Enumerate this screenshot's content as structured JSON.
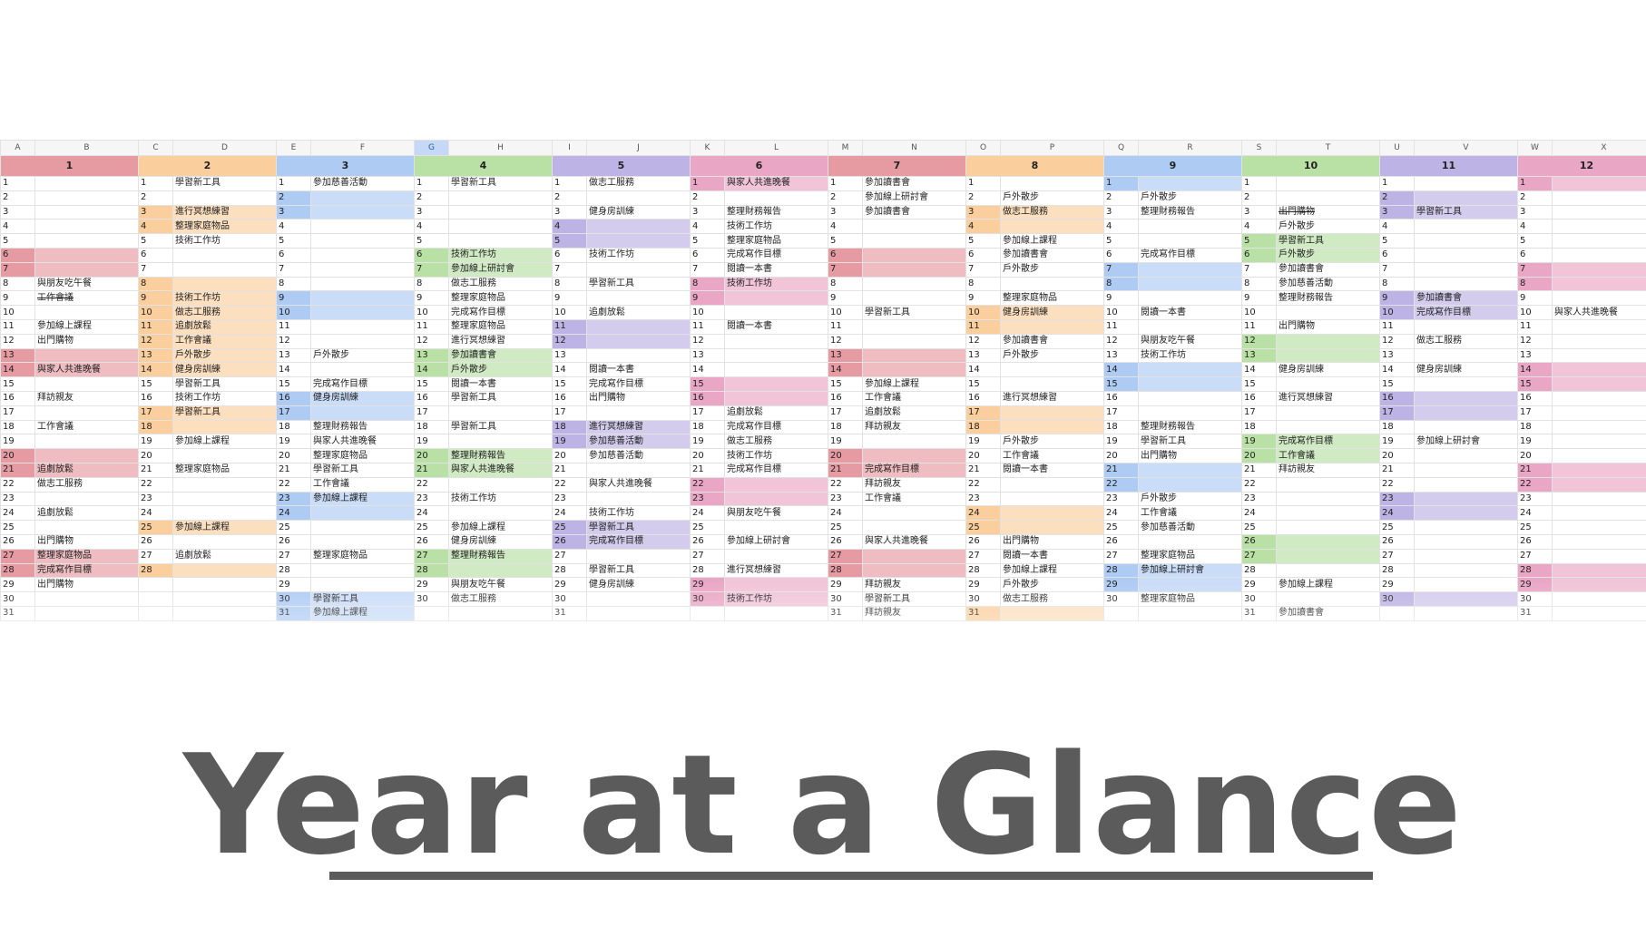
{
  "page_title": "Year at a Glance",
  "colors": {
    "1": "#e69aa2",
    "2": "#fbcf9d",
    "3": "#aecbf4",
    "4": "#b9e0a5",
    "5": "#bdb3e4",
    "6": "#eaa7c5",
    "7": "#e69aa2",
    "8": "#fbcf9d",
    "9": "#aecbf4",
    "10": "#b9e0a5",
    "11": "#bdb3e4",
    "12": "#eaa7c5"
  },
  "spreadsheet": {
    "column_headers": [
      "A",
      "B",
      "C",
      "D",
      "E",
      "F",
      "G",
      "H",
      "I",
      "J",
      "K",
      "L",
      "M",
      "N",
      "O",
      "P",
      "Q",
      "R",
      "S",
      "T",
      "U",
      "V",
      "W",
      "X"
    ],
    "selected_column": "G",
    "months": [
      {
        "label": "1",
        "days": 31,
        "highlights": [
          6,
          7,
          13,
          14,
          20,
          21,
          27,
          28
        ],
        "events": {
          "8": "與朋友吃午餐",
          "9": "工作會議",
          "11": "參加線上課程",
          "12": "出門購物",
          "14": "與家人共進晚餐",
          "16": "拜訪親友",
          "18": "工作會議",
          "21": "追劇放鬆",
          "22": "做志工服務",
          "24": "追劇放鬆",
          "26": "出門購物",
          "27": "整理家庭物品",
          "28": "完成寫作目標",
          "29": "出門購物"
        },
        "strike": [
          9
        ]
      },
      {
        "label": "2",
        "days": 28,
        "highlights": [
          3,
          4,
          8,
          9,
          10,
          11,
          12,
          13,
          14,
          17,
          18,
          25,
          28
        ],
        "events": {
          "1": "學習新工具",
          "3": "進行冥想練習",
          "4": "整理家庭物品",
          "5": "技術工作坊",
          "9": "技術工作坊",
          "10": "做志工服務",
          "11": "追劇放鬆",
          "12": "工作會議",
          "13": "戶外散步",
          "14": "健身房訓練",
          "15": "學習新工具",
          "16": "技術工作坊",
          "17": "學習新工具",
          "19": "參加線上課程",
          "21": "整理家庭物品",
          "25": "參加線上課程",
          "27": "追劇放鬆"
        }
      },
      {
        "label": "3",
        "days": 31,
        "highlights": [
          2,
          3,
          9,
          10,
          16,
          17,
          23,
          24,
          30,
          31
        ],
        "events": {
          "1": "參加慈善活動",
          "13": "戶外散步",
          "15": "完成寫作目標",
          "16": "健身房訓練",
          "18": "整理財務報告",
          "19": "與家人共進晚餐",
          "20": "整理家庭物品",
          "21": "學習新工具",
          "22": "工作會議",
          "23": "參加線上課程",
          "27": "整理家庭物品",
          "30": "學習新工具",
          "31": "參加線上課程"
        }
      },
      {
        "label": "4",
        "days": 30,
        "highlights": [
          6,
          7,
          13,
          14,
          20,
          21,
          27,
          28
        ],
        "events": {
          "1": "學習新工具",
          "6": "技術工作坊",
          "7": "參加線上研討會",
          "8": "做志工服務",
          "9": "整理家庭物品",
          "10": "完成寫作目標",
          "11": "整理家庭物品",
          "12": "進行冥想練習",
          "13": "參加讀書會",
          "14": "戶外散步",
          "15": "閱讀一本書",
          "16": "學習新工具",
          "18": "學習新工具",
          "20": "整理財務報告",
          "21": "與家人共進晚餐",
          "23": "技術工作坊",
          "25": "參加線上課程",
          "26": "健身房訓練",
          "27": "整理財務報告",
          "29": "與朋友吃午餐",
          "30": "做志工服務"
        }
      },
      {
        "label": "5",
        "days": 31,
        "highlights": [
          4,
          5,
          11,
          12,
          18,
          19,
          25,
          26
        ],
        "events": {
          "1": "做志工服務",
          "3": "健身房訓練",
          "6": "技術工作坊",
          "8": "學習新工具",
          "10": "追劇放鬆",
          "14": "閱讀一本書",
          "15": "完成寫作目標",
          "16": "出門購物",
          "18": "進行冥想練習",
          "19": "參加慈善活動",
          "20": "參加慈善活動",
          "22": "與家人共進晚餐",
          "24": "技術工作坊",
          "25": "學習新工具",
          "26": "完成寫作目標",
          "28": "學習新工具",
          "29": "健身房訓練"
        }
      },
      {
        "label": "6",
        "days": 30,
        "highlights": [
          1,
          8,
          9,
          15,
          16,
          22,
          23,
          29,
          30
        ],
        "events": {
          "1": "與家人共進晚餐",
          "3": "整理財務報告",
          "4": "技術工作坊",
          "5": "整理家庭物品",
          "6": "完成寫作目標",
          "7": "閱讀一本書",
          "8": "技術工作坊",
          "11": "閱讀一本書",
          "17": "追劇放鬆",
          "18": "完成寫作目標",
          "19": "做志工服務",
          "20": "技術工作坊",
          "21": "完成寫作目標",
          "24": "與朋友吃午餐",
          "26": "參加線上研討會",
          "28": "進行冥想練習",
          "30": "技術工作坊"
        }
      },
      {
        "label": "7",
        "days": 31,
        "highlights": [
          6,
          7,
          13,
          14,
          20,
          21,
          27,
          28
        ],
        "events": {
          "1": "參加讀書會",
          "2": "參加線上研討會",
          "3": "參加讀書會",
          "10": "學習新工具",
          "15": "參加線上課程",
          "16": "工作會議",
          "17": "追劇放鬆",
          "18": "拜訪親友",
          "21": "完成寫作目標",
          "22": "拜訪親友",
          "23": "工作會議",
          "26": "與家人共進晚餐",
          "29": "拜訪親友",
          "30": "學習新工具",
          "31": "拜訪親友"
        }
      },
      {
        "label": "8",
        "days": 31,
        "highlights": [
          3,
          4,
          10,
          11,
          17,
          18,
          24,
          25,
          31
        ],
        "events": {
          "2": "戶外散步",
          "3": "做志工服務",
          "5": "參加線上課程",
          "6": "參加讀書會",
          "7": "戶外散步",
          "9": "整理家庭物品",
          "10": "健身房訓練",
          "12": "參加讀書會",
          "13": "戶外散步",
          "16": "進行冥想練習",
          "19": "戶外散步",
          "20": "工作會議",
          "21": "閱讀一本書",
          "26": "出門購物",
          "27": "閱讀一本書",
          "28": "參加線上課程",
          "29": "戶外散步",
          "30": "做志工服務"
        }
      },
      {
        "label": "9",
        "days": 30,
        "highlights": [
          1,
          7,
          8,
          14,
          15,
          21,
          22,
          28,
          29
        ],
        "events": {
          "2": "戶外散步",
          "3": "整理財務報告",
          "6": "完成寫作目標",
          "10": "閱讀一本書",
          "12": "與朋友吃午餐",
          "13": "技術工作坊",
          "18": "整理財務報告",
          "19": "學習新工具",
          "20": "出門購物",
          "23": "戶外散步",
          "24": "工作會議",
          "25": "參加慈善活動",
          "27": "整理家庭物品",
          "28": "參加線上研討會",
          "30": "整理家庭物品"
        }
      },
      {
        "label": "10",
        "days": 31,
        "highlights": [
          5,
          6,
          12,
          13,
          19,
          20,
          26,
          27
        ],
        "events": {
          "3": "出門購物",
          "4": "戶外散步",
          "5": "學習新工具",
          "6": "戶外散步",
          "7": "參加讀書會",
          "8": "參加慈善活動",
          "9": "整理財務報告",
          "11": "出門購物",
          "14": "健身房訓練",
          "16": "進行冥想練習",
          "19": "完成寫作目標",
          "20": "工作會議",
          "21": "拜訪親友",
          "29": "參加線上課程",
          "31": "參加讀書會"
        },
        "strike": [
          3
        ]
      },
      {
        "label": "11",
        "days": 30,
        "highlights": [
          2,
          3,
          9,
          10,
          16,
          17,
          23,
          24,
          30
        ],
        "events": {
          "3": "學習新工具",
          "9": "參加讀書會",
          "10": "完成寫作目標",
          "12": "做志工服務",
          "14": "健身房訓練",
          "19": "參加線上研討會"
        }
      },
      {
        "label": "12",
        "days": 31,
        "highlights": [
          1,
          7,
          8,
          14,
          15,
          21,
          22,
          28,
          29
        ],
        "events": {
          "10": "與家人共進晚餐"
        }
      }
    ]
  }
}
